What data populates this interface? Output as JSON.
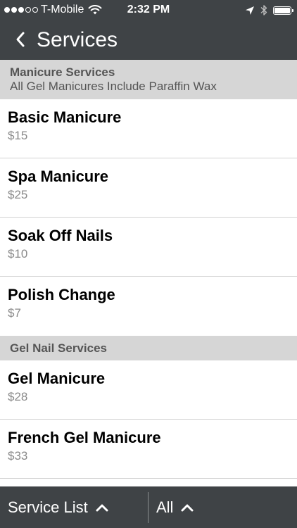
{
  "status_bar": {
    "carrier": "T-Mobile",
    "time": "2:32 PM",
    "signal_filled": 3,
    "signal_total": 5,
    "battery_level": 1.0
  },
  "nav": {
    "title": "Services"
  },
  "sections": [
    {
      "title": "Manicure Services",
      "subtitle": "All Gel Manicures Include Paraffin Wax",
      "items": [
        {
          "name": "Basic Manicure",
          "price": "$15"
        },
        {
          "name": "Spa Manicure",
          "price": "$25"
        },
        {
          "name": "Soak Off Nails",
          "price": "$10"
        },
        {
          "name": "Polish Change",
          "price": "$7"
        }
      ]
    },
    {
      "title": "Gel Nail Services",
      "items": [
        {
          "name": "Gel Manicure",
          "price": "$28"
        },
        {
          "name": "French Gel Manicure",
          "price": "$33"
        }
      ]
    }
  ],
  "bottom_bar": {
    "left_label": "Service List",
    "right_label": "All"
  },
  "colors": {
    "bar_background": "#3f4346",
    "section_background": "#d6d6d6",
    "price_text": "#8a8a8a"
  }
}
